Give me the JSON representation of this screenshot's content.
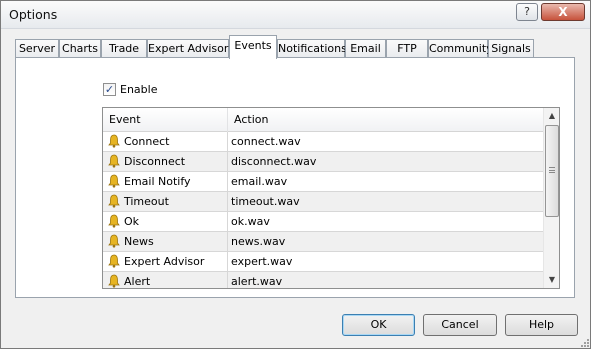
{
  "window": {
    "title": "Options",
    "help_glyph": "?",
    "close_glyph": "X"
  },
  "tabs": [
    {
      "label": "Server",
      "active": false
    },
    {
      "label": "Charts",
      "active": false
    },
    {
      "label": "Trade",
      "active": false
    },
    {
      "label": "Expert Advisors",
      "active": false
    },
    {
      "label": "Events",
      "active": true
    },
    {
      "label": "Notifications",
      "active": false
    },
    {
      "label": "Email",
      "active": false
    },
    {
      "label": "FTP",
      "active": false
    },
    {
      "label": "Community",
      "active": false
    },
    {
      "label": "Signals",
      "active": false
    }
  ],
  "enable": {
    "label": "Enable",
    "checked": true
  },
  "table": {
    "columns": [
      "Event",
      "Action"
    ],
    "rows": [
      {
        "event": "Connect",
        "action": "connect.wav",
        "icon": "bell-icon"
      },
      {
        "event": "Disconnect",
        "action": "disconnect.wav",
        "icon": "bell-icon"
      },
      {
        "event": "Email Notify",
        "action": "email.wav",
        "icon": "bell-icon"
      },
      {
        "event": "Timeout",
        "action": "timeout.wav",
        "icon": "bell-icon"
      },
      {
        "event": "Ok",
        "action": "ok.wav",
        "icon": "bell-icon"
      },
      {
        "event": "News",
        "action": "news.wav",
        "icon": "bell-icon"
      },
      {
        "event": "Expert Advisor",
        "action": "expert.wav",
        "icon": "bell-icon"
      },
      {
        "event": "Alert",
        "action": "alert.wav",
        "icon": "bell-icon"
      }
    ]
  },
  "buttons": {
    "ok": "OK",
    "cancel": "Cancel",
    "help": "Help"
  },
  "colors": {
    "default_button_border": "#3c7fb1",
    "bell": "#e6b422",
    "alt_row": "#f0f0f0"
  }
}
